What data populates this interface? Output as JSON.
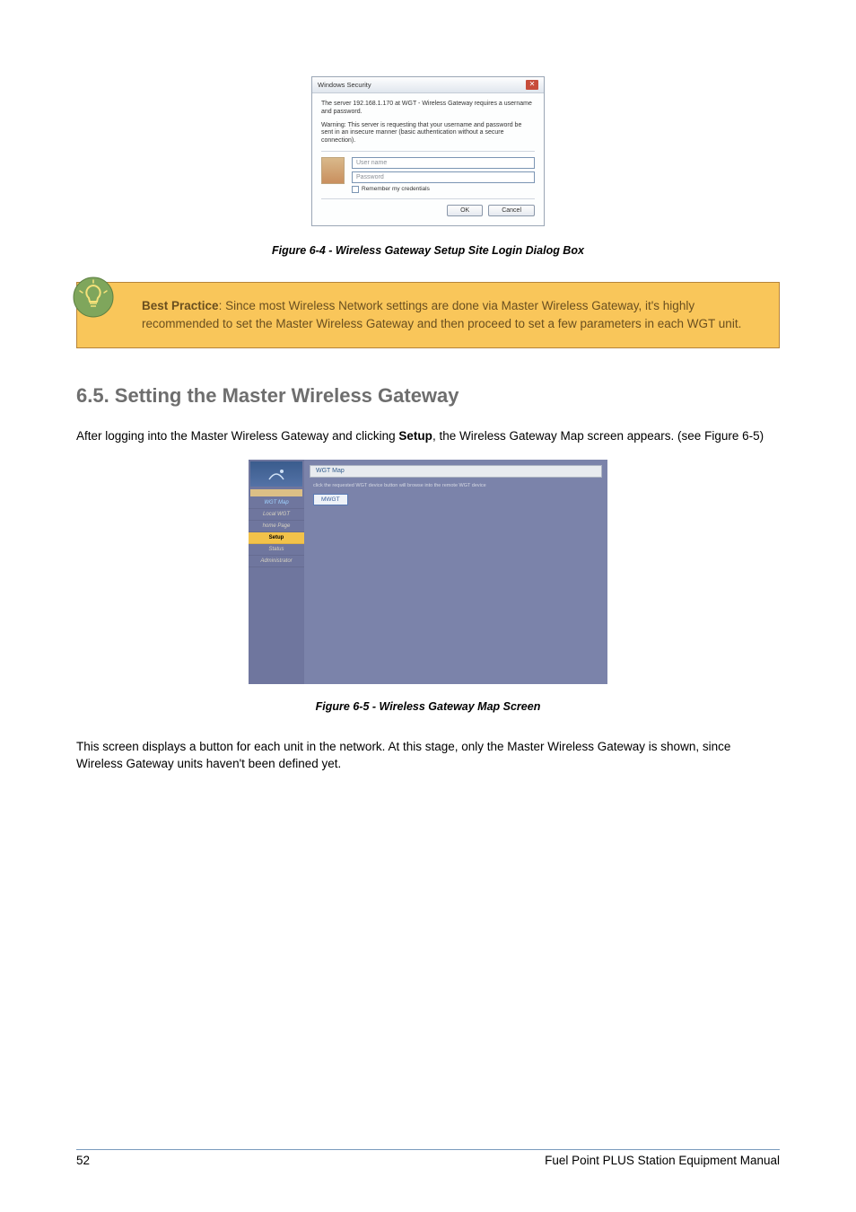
{
  "dialog": {
    "title": "Windows Security",
    "text1": "The server 192.168.1.170 at WGT - Wireless Gateway requires a username and password.",
    "text2": "Warning: This server is requesting that your username and password be sent in an insecure manner (basic authentication without a secure connection).",
    "username_placeholder": "User name",
    "password_placeholder": "Password",
    "remember_label": "Remember my credentials",
    "ok_label": "OK",
    "cancel_label": "Cancel"
  },
  "figure1_caption": "Figure 6-4 - Wireless Gateway Setup Site Login Dialog Box",
  "callout": {
    "bold_label": "Best Practice",
    "text": ": Since most Wireless Network settings are done via Master Wireless Gateway, it's highly recommended to set the Master Wireless Gateway and then proceed to set a few parameters in each WGT unit."
  },
  "section_heading": "6.5. Setting the Master Wireless Gateway",
  "paragraph1_a": "After logging into the Master Wireless Gateway and clicking ",
  "paragraph1_bold": "Setup",
  "paragraph1_b": ", the Wireless Gateway Map screen appears.  (see Figure 6-5)",
  "wgt": {
    "panel_title": "WGT Map",
    "subtext": "click the requested WGT device button will browse into the remote WGT device",
    "button_label": "MWGT",
    "sidebar": {
      "item0": "WGT Map",
      "item1": "Local WGT",
      "item2": "home Page",
      "item3": "Setup",
      "item4": "Status",
      "item5": "Administrator"
    }
  },
  "figure2_caption": "Figure 6-5 - Wireless Gateway Map Screen",
  "paragraph2": "This screen displays a button for each unit in the network. At this stage, only the Master Wireless Gateway is shown, since Wireless Gateway units haven't been defined yet.",
  "footer": {
    "page": "52",
    "title": "Fuel Point PLUS Station Equipment Manual"
  }
}
